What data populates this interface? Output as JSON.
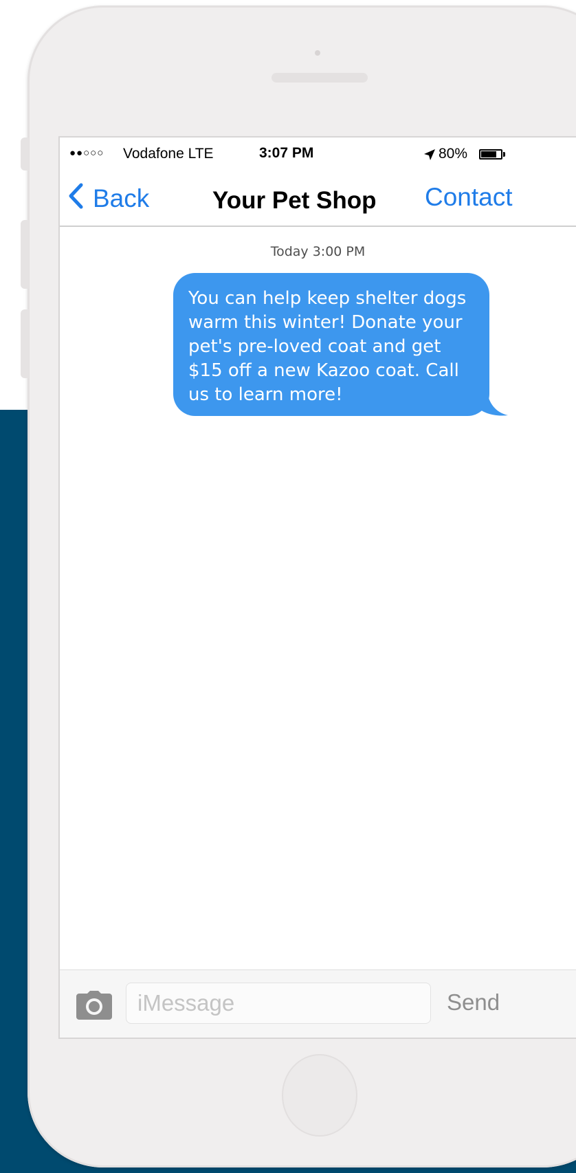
{
  "status_bar": {
    "signal": "●●○○○",
    "carrier": "Vodafone LTE",
    "time": "3:07 PM",
    "location_icon": "location-arrow-icon",
    "battery_percent": "80%",
    "battery_level": 0.8
  },
  "nav": {
    "back_label": "Back",
    "title": "Your Pet Shop",
    "contact_label": "Contact"
  },
  "conversation": {
    "timestamp": "Today 3:00 PM",
    "messages": [
      {
        "direction": "outgoing",
        "text": "You can help keep shelter dogs warm this winter! Donate your pet's pre-loved coat and get $15 off a new Kazoo coat. Call us to learn more!"
      }
    ]
  },
  "composer": {
    "placeholder": "iMessage",
    "value": "",
    "send_label": "Send",
    "camera_icon": "camera-icon"
  },
  "colors": {
    "background_panel": "#004a6f",
    "bubble": "#3d97ee",
    "accent": "#1f7ce8",
    "phone_body": "#f0eeee"
  }
}
